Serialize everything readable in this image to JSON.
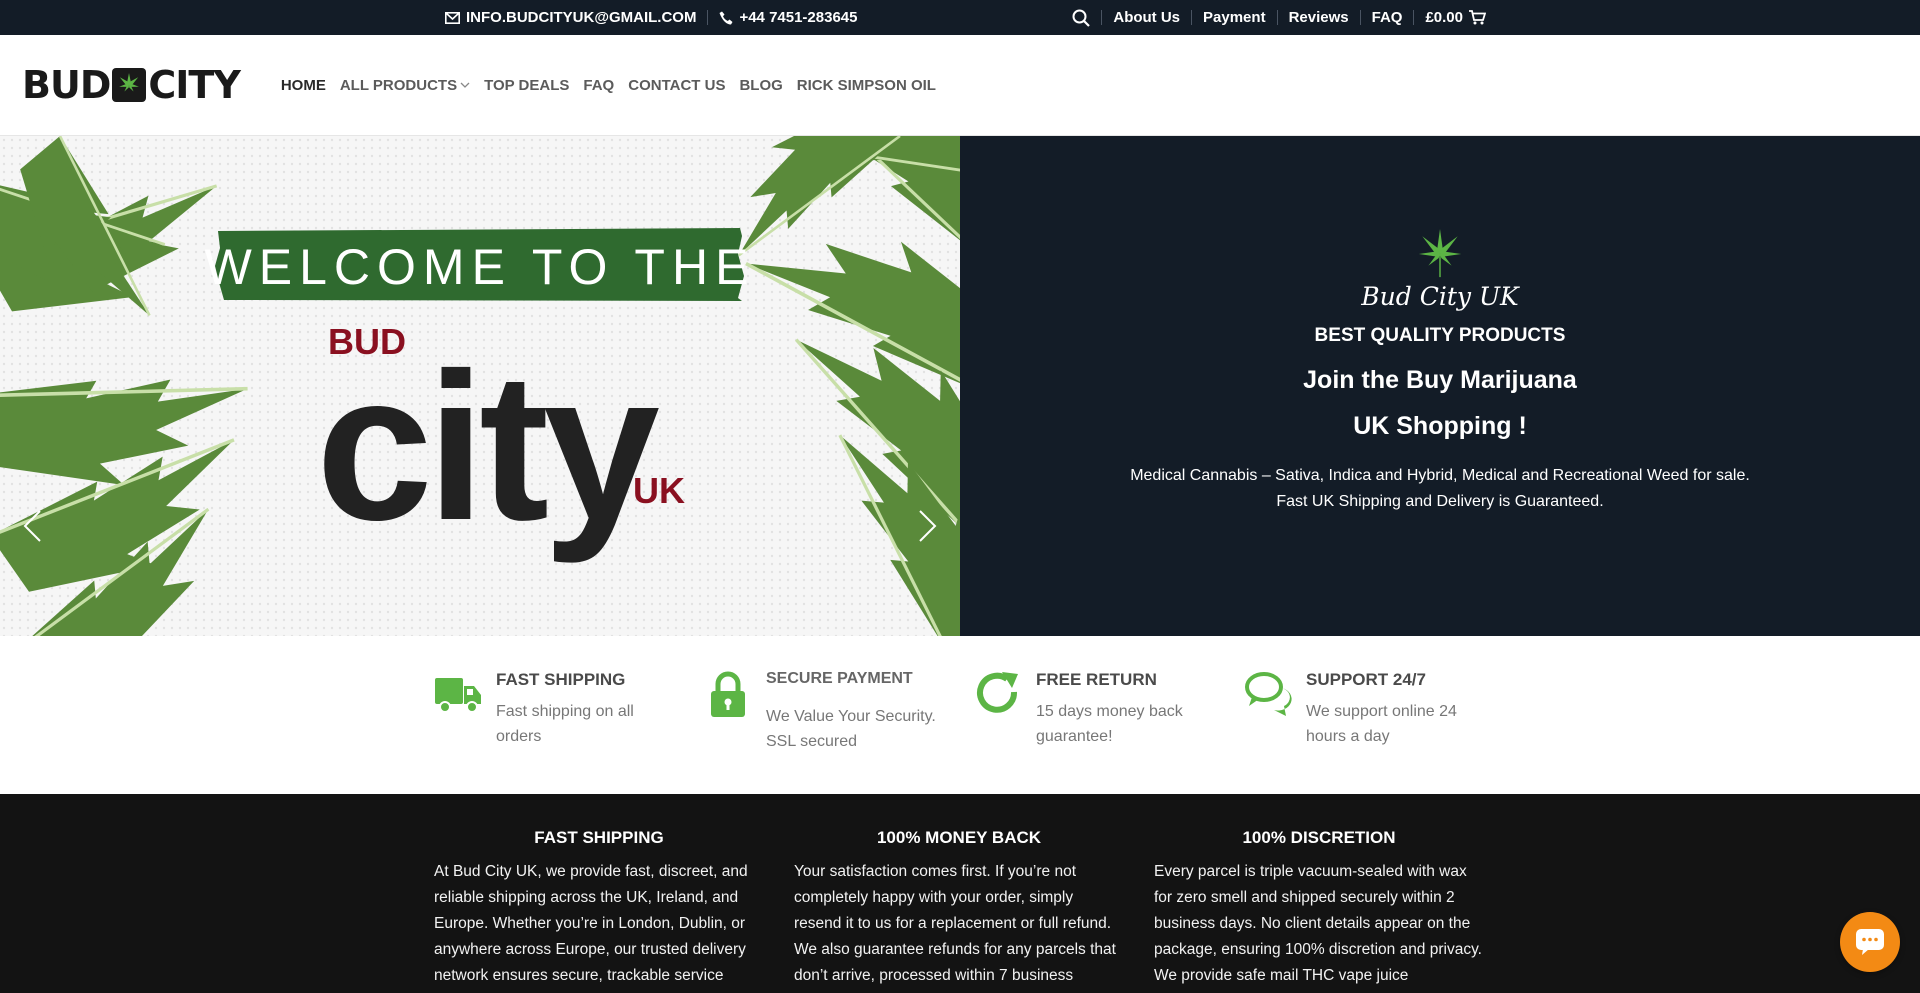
{
  "topbar": {
    "email": "INFO.BUDCITYUK@GMAIL.COM",
    "phone": "+44 7451-283645",
    "links": [
      "About Us",
      "Payment",
      "Reviews",
      "FAQ"
    ],
    "cart_total": "£0.00"
  },
  "header": {
    "logo_left": "BUD",
    "logo_right": "CITY",
    "nav": [
      {
        "label": "HOME",
        "active": true
      },
      {
        "label": "ALL PRODUCTS",
        "dropdown": true
      },
      {
        "label": "TOP DEALS"
      },
      {
        "label": "FAQ"
      },
      {
        "label": "CONTACT US"
      },
      {
        "label": "BLOG"
      },
      {
        "label": "RICK SIMPSON OIL"
      }
    ]
  },
  "hero": {
    "banner": {
      "welcome": "WELCOME TO THE",
      "bud": "BUD",
      "city": "city",
      "uk": "UK"
    },
    "right": {
      "script_title": "Bud City UK",
      "subtitle": "BEST QUALITY PRODUCTS",
      "heading_line1": "Join the Buy Marijuana",
      "heading_line2": "UK Shopping !",
      "desc_line1": "Medical Cannabis – Sativa, Indica and Hybrid, Medical and Recreational Weed for sale.",
      "desc_line2": "Fast UK Shipping and Delivery is Guaranteed."
    }
  },
  "features": [
    {
      "icon": "truck-icon",
      "title": "FAST SHIPPING",
      "text_line1": "Fast shipping on all",
      "text_line2": "orders"
    },
    {
      "icon": "lock-icon",
      "title": "SECURE PAYMENT",
      "text_line1": "We Value Your Security.",
      "text_line2": "SSL secured"
    },
    {
      "icon": "refresh-icon",
      "title": "FREE RETURN",
      "text_line1": "15 days money back",
      "text_line2": "guarantee!"
    },
    {
      "icon": "chat-icon",
      "title": "SUPPORT 24/7",
      "text_line1": "We support online 24",
      "text_line2": "hours a day"
    }
  ],
  "footer": [
    {
      "title": "FAST SHIPPING",
      "text": "At Bud City UK, we provide fast, discreet, and reliable shipping across the UK, Ireland, and Europe. Whether you’re in London, Dublin, or anywhere across Europe, our trusted delivery network ensures secure, trackable service"
    },
    {
      "title": "100% MONEY BACK",
      "text": "Your satisfaction comes first. If you’re not completely happy with your order, simply resend it to us for a replacement or full refund. We also guarantee refunds for any parcels that don’t arrive, processed within 7 business"
    },
    {
      "title": "100% DISCRETION",
      "text": "Every parcel is triple vacuum-sealed with wax for zero smell and shipped securely within 2 business days. No client details appear on the package, ensuring 100% discretion and privacy. We provide safe mail THC vape juice"
    }
  ],
  "colors": {
    "dark": "#131c27",
    "accent_green": "#5cb545",
    "brand_red": "#8a1020",
    "chat_orange": "#f38a14"
  }
}
